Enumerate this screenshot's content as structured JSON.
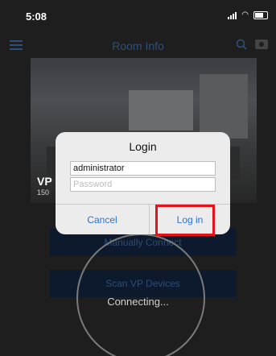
{
  "status_bar": {
    "time": "5:08"
  },
  "nav": {
    "title": "Room Info"
  },
  "room": {
    "name": "VP",
    "sub": "150"
  },
  "buttons": {
    "manually_connect": "Manually Connect",
    "scan_devices": "Scan VP Devices"
  },
  "progress": {
    "label": "Connecting..."
  },
  "login_dialog": {
    "title": "Login",
    "username_value": "administrator",
    "password_placeholder": "Password",
    "cancel_label": "Cancel",
    "login_label": "Log in"
  },
  "colors": {
    "highlight": "#e3131b",
    "dialog_button": "#2a73d8"
  }
}
